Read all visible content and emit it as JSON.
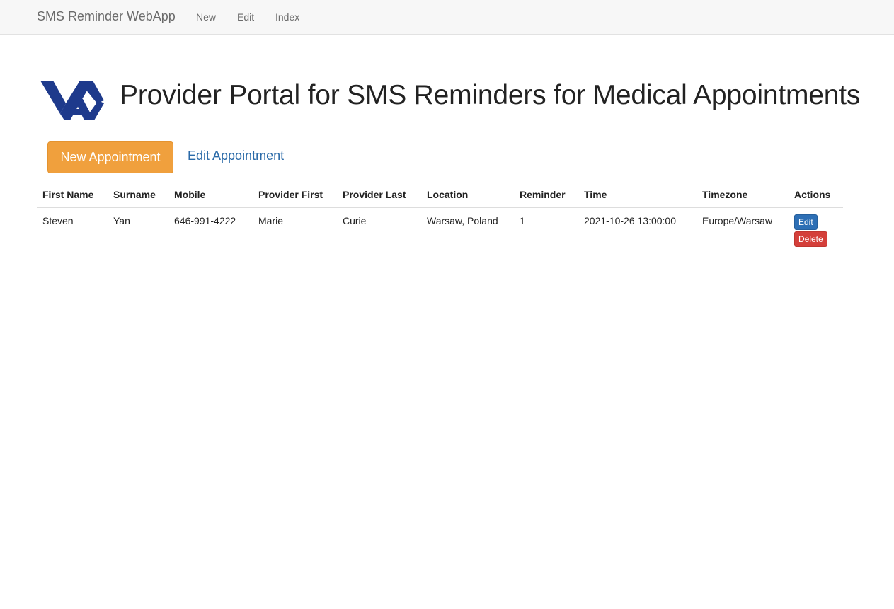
{
  "navbar": {
    "brand": "SMS Reminder WebApp",
    "links": [
      "New",
      "Edit",
      "Index"
    ]
  },
  "header": {
    "logo_name": "va-logo",
    "title": "Provider Portal for SMS Reminders for Medical Appointments"
  },
  "actions": {
    "new_button": "New Appointment",
    "edit_link": "Edit Appointment"
  },
  "table": {
    "columns": [
      "First Name",
      "Surname",
      "Mobile",
      "Provider First",
      "Provider Last",
      "Location",
      "Reminder",
      "Time",
      "Timezone",
      "Actions"
    ],
    "rows": [
      {
        "first_name": "Steven",
        "surname": "Yan",
        "mobile": "646-991-4222",
        "provider_first": "Marie",
        "provider_last": "Curie",
        "location": "Warsaw, Poland",
        "reminder": "1",
        "time": "2021-10-26 13:00:00",
        "timezone": "Europe/Warsaw",
        "edit_label": "Edit",
        "delete_label": "Delete"
      }
    ]
  },
  "colors": {
    "navbar_bg": "#f7f7f7",
    "primary_orange": "#f0a03d",
    "link_blue": "#2a6aa8",
    "edit_blue": "#2d6fb5",
    "delete_red": "#d43f3a",
    "logo_navy": "#1e3a8c"
  }
}
